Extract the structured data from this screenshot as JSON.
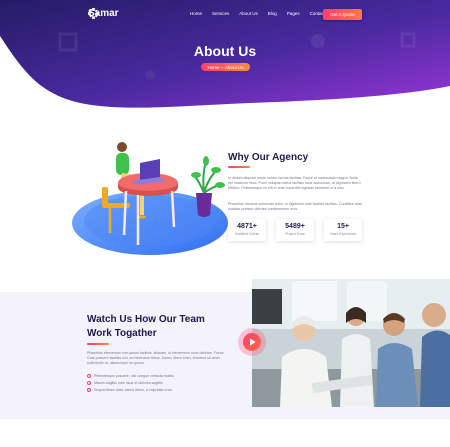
{
  "brand": {
    "name": "Samar"
  },
  "nav": {
    "items": [
      "Home",
      "Services",
      "About Us",
      "Blog",
      "Pages",
      "Contact Us"
    ],
    "cta_label": "Get A Quote"
  },
  "hero": {
    "title": "About Us",
    "breadcrumb": {
      "home": "Home",
      "separator": "›",
      "current": "About Us"
    }
  },
  "agency": {
    "title": "Why Our Agency",
    "paragraph_1": "In dictum aliquam turpis ornare lacinia facilisis. Fusce at malesuada magna. Nulla vel maximus risus. Proin volutpat metus facilisis risus accumsan, at dignissim libero efficitur. Pellentesque eu elit et ante imperdiet egestas hendrerit ut a odio.",
    "paragraph_2": "Phasellus rhoncus commodo dolor, in dignissim ante facilisis facilisis. Curabitur vitae sodales pretium ultricies condimentum eros.",
    "stats": [
      {
        "value": "4871+",
        "label": "Satisfied Clients"
      },
      {
        "value": "5489+",
        "label": "Project Done"
      },
      {
        "value": "15+",
        "label": "Years Experience"
      }
    ]
  },
  "video": {
    "title_line_1": "Watch Us How Our Team",
    "title_line_2": "Work Togather",
    "paragraph": "Phasellus elementum non ipsum facilisis, aliquam, ut elementum nunc ultricies. Fusce. Cras posuere facilisis nisi, an bibendum tellus. Donec libero enim, tincidunt sit amet sollicitudin ut, ullamcorper eu ipsum.",
    "bullets": [
      "Pellentesque posuere, nisi congue vehicula mattis",
      "Mauris sagittis odio risus et ultricies sagittis",
      "Suspendisse dolor varius libero, a vulputate urna"
    ]
  },
  "colors": {
    "hero_start": "#2a1f6e",
    "hero_end": "#8b2fd6",
    "accent_start": "#ff3d6c",
    "accent_end": "#ff8a3d",
    "heading": "#1d1b4c"
  }
}
